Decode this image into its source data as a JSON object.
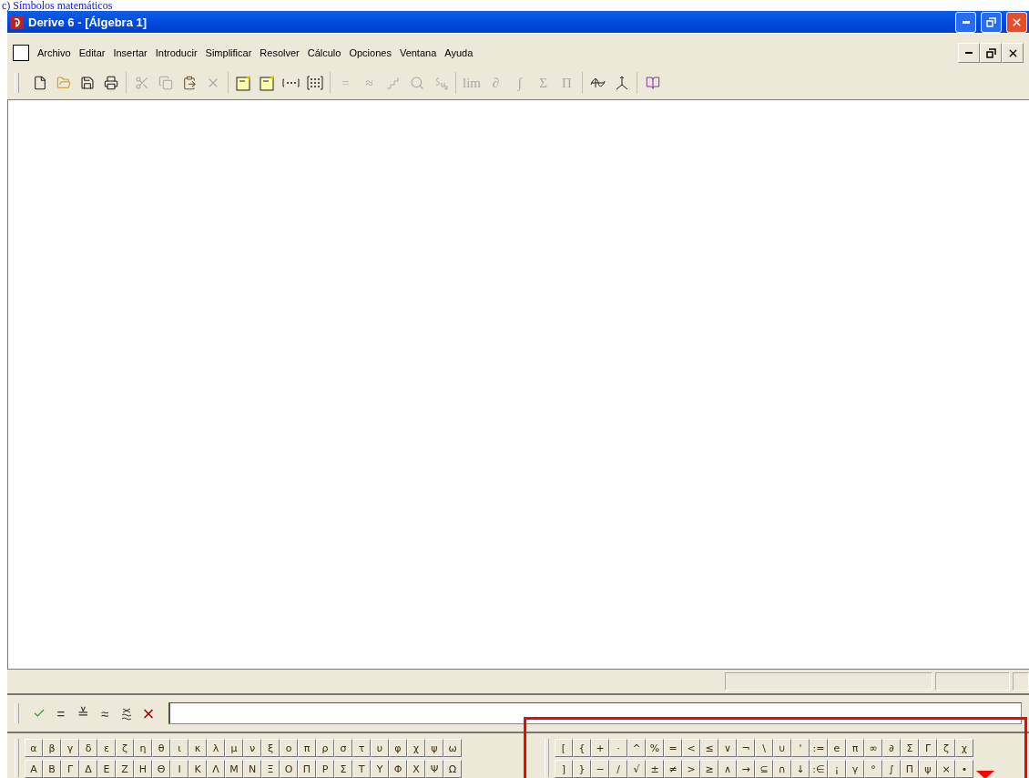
{
  "heading": "c) Símbolos matemáticos",
  "window": {
    "title": "Derive 6 - [Álgebra 1]"
  },
  "menu": [
    "Archivo",
    "Editar",
    "Insertar",
    "Introducir",
    "Simplificar",
    "Resolver",
    "Cálculo",
    "Opciones",
    "Ventana",
    "Ayuda"
  ],
  "toolbar": [
    [
      {
        "kind": "new",
        "disabled": false
      },
      {
        "kind": "open",
        "disabled": false
      },
      {
        "kind": "save",
        "disabled": false
      },
      {
        "kind": "print",
        "disabled": false
      }
    ],
    [
      {
        "kind": "cut",
        "disabled": true
      },
      {
        "kind": "copy",
        "disabled": true
      },
      {
        "kind": "paste",
        "disabled": false
      },
      {
        "kind": "delete",
        "disabled": true
      }
    ],
    [
      {
        "kind": "note",
        "disabled": false
      },
      {
        "kind": "expression",
        "disabled": false
      },
      {
        "kind": "vector",
        "disabled": false
      },
      {
        "kind": "matrix",
        "disabled": false
      }
    ],
    [
      {
        "kind": "glyph",
        "label": "=",
        "disabled": true
      },
      {
        "kind": "glyph",
        "label": "≈",
        "disabled": true
      },
      {
        "kind": "steps",
        "disabled": true
      },
      {
        "kind": "zoom",
        "disabled": true
      },
      {
        "kind": "substitute",
        "disabled": true
      }
    ],
    [
      {
        "kind": "glyph",
        "label": "lim",
        "disabled": true
      },
      {
        "kind": "glyph",
        "label": "∂",
        "disabled": true
      },
      {
        "kind": "glyph",
        "label": "∫",
        "disabled": true
      },
      {
        "kind": "glyph",
        "label": "Σ",
        "disabled": true
      },
      {
        "kind": "glyph",
        "label": "Π",
        "disabled": true
      }
    ],
    [
      {
        "kind": "plot2d",
        "disabled": false
      },
      {
        "kind": "plot3d",
        "disabled": false
      }
    ],
    [
      {
        "kind": "book",
        "disabled": false
      }
    ]
  ],
  "entry_bar": {
    "buttons": [
      {
        "kind": "check"
      },
      {
        "kind": "glyph",
        "label": "="
      },
      {
        "kind": "glyph",
        "label": "≚"
      },
      {
        "kind": "glyph",
        "label": "≈"
      },
      {
        "kind": "approx-simplify"
      },
      {
        "kind": "cross"
      }
    ]
  },
  "greek_rows": [
    [
      "α",
      "β",
      "γ",
      "δ",
      "ε",
      "ζ",
      "η",
      "θ",
      "ι",
      "κ",
      "λ",
      "μ",
      "ν",
      "ξ",
      "ο",
      "π",
      "ρ",
      "σ",
      "τ",
      "υ",
      "φ",
      "χ",
      "ψ",
      "ω"
    ],
    [
      "Α",
      "Β",
      "Γ",
      "Δ",
      "Ε",
      "Ζ",
      "Η",
      "Θ",
      "Ι",
      "Κ",
      "Λ",
      "Μ",
      "Ν",
      "Ξ",
      "Ο",
      "Π",
      "Ρ",
      "Σ",
      "Τ",
      "Υ",
      "Φ",
      "Χ",
      "Ψ",
      "Ω"
    ]
  ],
  "symbol_rows": [
    [
      "[",
      "{",
      "+",
      "·",
      "^",
      "%",
      "=",
      "<",
      "≤",
      "∨",
      "¬",
      "\\",
      "∪",
      "'",
      ":=",
      "e",
      "π",
      "∞",
      "∂",
      "Σ",
      "Γ",
      "ζ",
      "χ"
    ],
    [
      "]",
      "}",
      "−",
      "/",
      "√",
      "±",
      "≠",
      ">",
      "≥",
      "∧",
      "→",
      "⊆",
      "∩",
      "↓",
      ":∈",
      "¡",
      "γ",
      "°",
      "∫",
      "Π",
      "ψ",
      "×",
      "•"
    ]
  ]
}
